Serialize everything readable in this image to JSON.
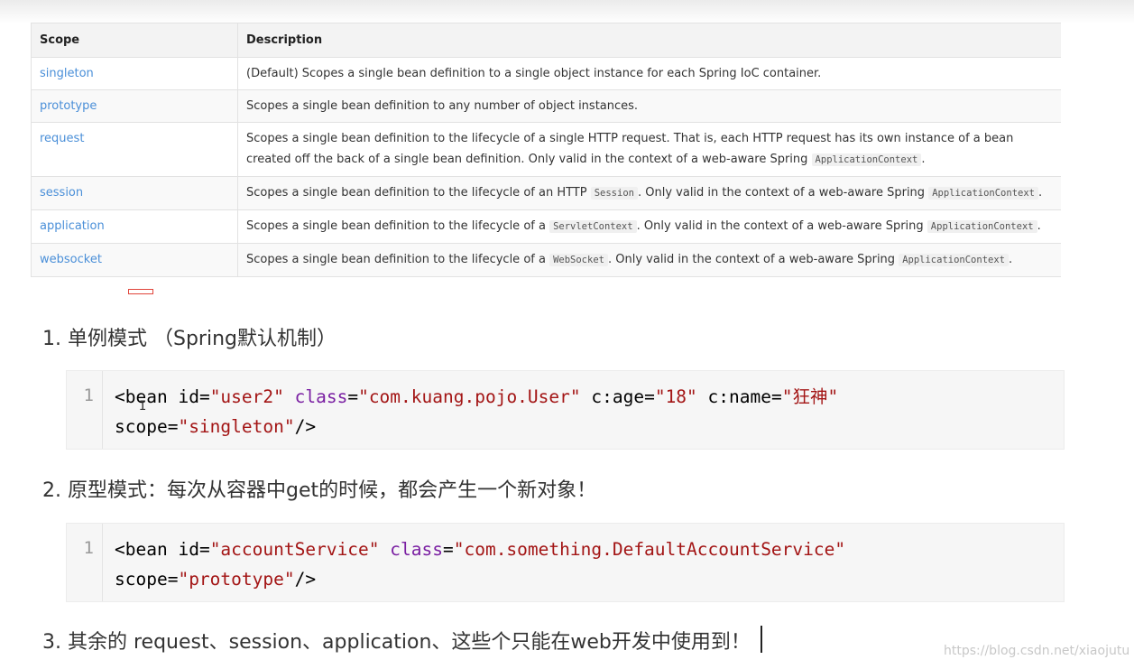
{
  "table": {
    "headers": [
      "Scope",
      "Description"
    ],
    "rows": [
      {
        "scope": "singleton",
        "desc": [
          {
            "t": "(Default) Scopes a single bean definition to a single object instance for each Spring IoC container."
          }
        ]
      },
      {
        "scope": "prototype",
        "desc": [
          {
            "t": "Scopes a single bean definition to any number of object instances."
          }
        ]
      },
      {
        "scope": "request",
        "desc": [
          {
            "t": "Scopes a single bean definition to the lifecycle of a single HTTP request. That is, each HTTP request has its own instance of a bean created off the back of a single bean definition. Only valid in the context of a web-aware Spring "
          },
          {
            "c": "ApplicationContext"
          },
          {
            "t": "."
          }
        ]
      },
      {
        "scope": "session",
        "desc": [
          {
            "t": "Scopes a single bean definition to the lifecycle of an HTTP "
          },
          {
            "c": "Session"
          },
          {
            "t": ". Only valid in the context of a web-aware Spring "
          },
          {
            "c": "ApplicationContext"
          },
          {
            "t": "."
          }
        ]
      },
      {
        "scope": "application",
        "desc": [
          {
            "t": "Scopes a single bean definition to the lifecycle of a "
          },
          {
            "c": "ServletContext"
          },
          {
            "t": ". Only valid in the context of a web-aware Spring "
          },
          {
            "c": "ApplicationContext"
          },
          {
            "t": "."
          }
        ]
      },
      {
        "scope": "websocket",
        "desc": [
          {
            "t": "Scopes a single bean definition to the lifecycle of a "
          },
          {
            "c": "WebSocket"
          },
          {
            "t": ". Only valid in the context of a web-aware Spring "
          },
          {
            "c": "ApplicationContext"
          },
          {
            "t": "."
          }
        ]
      }
    ]
  },
  "sections": {
    "item1": "1. 单例模式 （Spring默认机制）",
    "item2": "2. 原型模式：每次从容器中get的时候，都会产生一个新对象！",
    "item3": "3. 其余的 request、session、application、这些个只能在web开发中使用到！"
  },
  "code_blocks": [
    {
      "line_number": "1",
      "lines": [
        [
          {
            "k": "tag",
            "v": "<bean "
          },
          {
            "k": "attr",
            "v": "id"
          },
          {
            "k": "punct",
            "v": "="
          },
          {
            "k": "str",
            "v": "\"user2\""
          },
          {
            "k": "punct",
            "v": " "
          },
          {
            "k": "kw",
            "v": "class"
          },
          {
            "k": "punct",
            "v": "="
          },
          {
            "k": "str",
            "v": "\"com.kuang.pojo.User\""
          },
          {
            "k": "punct",
            "v": " "
          },
          {
            "k": "attr",
            "v": "c:age"
          },
          {
            "k": "punct",
            "v": "="
          },
          {
            "k": "str",
            "v": "\"18\""
          },
          {
            "k": "punct",
            "v": " "
          },
          {
            "k": "attr",
            "v": "c:name"
          },
          {
            "k": "punct",
            "v": "="
          },
          {
            "k": "str",
            "v": "\"狂神\""
          }
        ],
        [
          {
            "k": "attr",
            "v": "scope"
          },
          {
            "k": "punct",
            "v": "="
          },
          {
            "k": "str",
            "v": "\"singleton\""
          },
          {
            "k": "tag",
            "v": "/>"
          }
        ]
      ]
    },
    {
      "line_number": "1",
      "lines": [
        [
          {
            "k": "tag",
            "v": "<bean "
          },
          {
            "k": "attr",
            "v": "id"
          },
          {
            "k": "punct",
            "v": "="
          },
          {
            "k": "str",
            "v": "\"accountService\""
          },
          {
            "k": "punct",
            "v": " "
          },
          {
            "k": "kw",
            "v": "class"
          },
          {
            "k": "punct",
            "v": "="
          },
          {
            "k": "str",
            "v": "\"com.something.DefaultAccountService\""
          }
        ],
        [
          {
            "k": "attr",
            "v": "scope"
          },
          {
            "k": "punct",
            "v": "="
          },
          {
            "k": "str",
            "v": "\"prototype\""
          },
          {
            "k": "tag",
            "v": "/>"
          }
        ]
      ]
    }
  ],
  "watermark": "https://blog.csdn.net/xiaojutu",
  "cursor_glyph": "I"
}
